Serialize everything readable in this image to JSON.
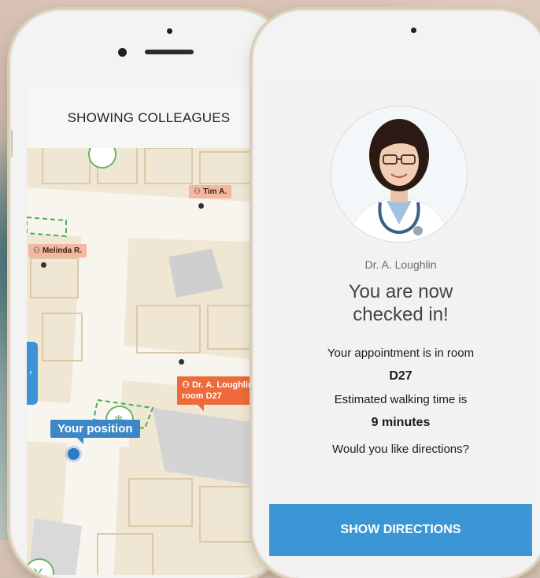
{
  "map_screen": {
    "title": "SHOWING COLLEAGUES",
    "colleagues": [
      {
        "name": "Tim A."
      },
      {
        "name": "Melinda R."
      }
    ],
    "doctor_pin": {
      "line1": "Dr. A. Loughlin",
      "line2": "room D27"
    },
    "position_label": "Your position",
    "icons": [
      "user-icon",
      "side-panel-chevron-icon",
      "pharmacy-icon"
    ]
  },
  "checkin_screen": {
    "doctor_name": "Dr. A. Loughlin",
    "status_line1": "You are now",
    "status_line2": "checked in!",
    "appointment_label": "Your appointment is in room",
    "room": "D27",
    "walking_label": "Estimated walking time is",
    "walking_time": "9 minutes",
    "question": "Would you like directions?",
    "button_label": "SHOW DIRECTIONS"
  },
  "colors": {
    "accent_blue": "#3b96d6",
    "doctor_pin": "#ee6a3a",
    "colleague_pin": "#f2b8a1",
    "position_blue": "#3d87c9"
  }
}
